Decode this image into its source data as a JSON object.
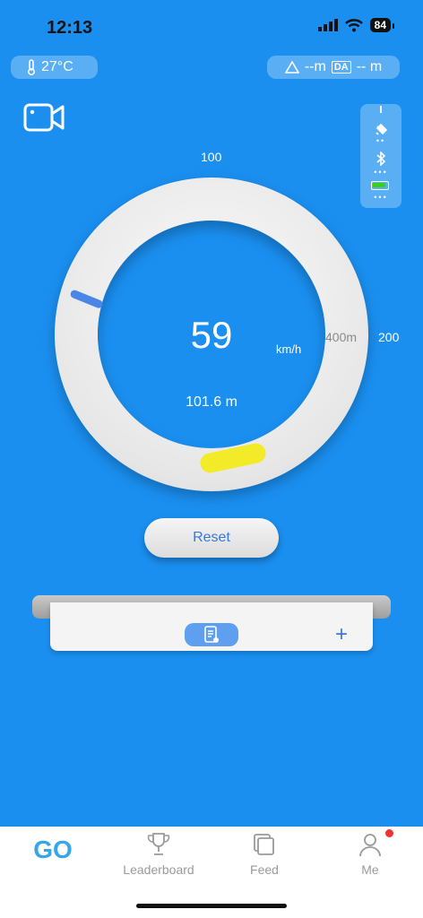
{
  "status_bar": {
    "time": "12:13",
    "battery": "84"
  },
  "temperature": {
    "value": "27°C"
  },
  "altitude": {
    "alt_value": "--m",
    "da_label": "DA",
    "da_value": "-- m"
  },
  "gauge": {
    "tick_top": "100",
    "tick_right": "200",
    "speed": "59",
    "speed_unit": "km/h",
    "distance_marker": "400m",
    "distance": "101.6 m"
  },
  "buttons": {
    "reset": "Reset",
    "plus": "+"
  },
  "tabs": [
    {
      "label": "GO"
    },
    {
      "label": "Leaderboard"
    },
    {
      "label": "Feed"
    },
    {
      "label": "Me"
    }
  ],
  "colors": {
    "background": "#1a8ff0",
    "accent": "#3a77d8",
    "battery_green": "#38d020",
    "marker_yellow": "#f3ea28",
    "notify_red": "#f03232"
  }
}
